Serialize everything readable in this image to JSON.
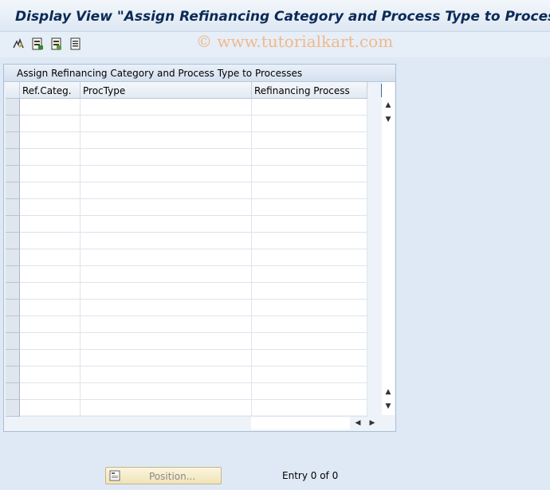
{
  "window": {
    "title": "Display View \"Assign Refinancing Category and Process Type to Processe"
  },
  "toolbar": {
    "icons": [
      "edit-glasses-icon",
      "select-all-icon",
      "details-icon",
      "print-icon"
    ]
  },
  "watermark": "© www.tutorialkart.com",
  "panel": {
    "title": "Assign Refinancing Category and Process Type to Processes",
    "columns": [
      "Ref.Categ.",
      "ProcType",
      "Refinancing Process"
    ],
    "rows": 19
  },
  "footer": {
    "position_label": "Position...",
    "entry_text": "Entry 0 of 0"
  },
  "colors": {
    "background": "#dfe9f5",
    "title": "#0b2a57",
    "watermark": "#f0b98a",
    "button": "#efe3b8"
  }
}
